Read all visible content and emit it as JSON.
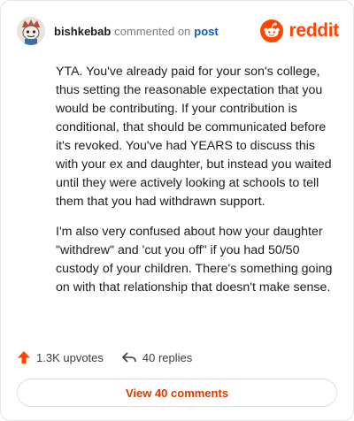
{
  "header": {
    "username": "bishkebab",
    "commented_text": "commented on",
    "post_link": "post",
    "brand": "reddit"
  },
  "comment": {
    "paragraphs": [
      "YTA. You've already paid for your son's college, thus setting the reasonable expectation that you would be contributing. If your contribution is conditional, that should be communicated before it's revoked. You've had YEARS to discuss this with your ex and daughter, but instead you waited until they were actively looking at schools to tell them that you had withdrawn support.",
      "I'm also very confused about how your daughter \"withdrew\" and 'cut you off\" if you had 50/50 custody of your children. There's something going on with that relationship that doesn't make sense."
    ]
  },
  "actions": {
    "upvotes": "1.3K upvotes",
    "replies": "40 replies"
  },
  "footer": {
    "view_comments": "View 40 comments"
  },
  "colors": {
    "brand": "#ff4500",
    "upvote": "#ff4500",
    "link": "#0a5fc4",
    "view_button_text": "#d93a00"
  },
  "icons": {
    "avatar": "avatar",
    "brand_logo": "reddit-logo-icon",
    "upvote": "upvote-arrow-icon",
    "reply": "reply-arrow-icon"
  }
}
